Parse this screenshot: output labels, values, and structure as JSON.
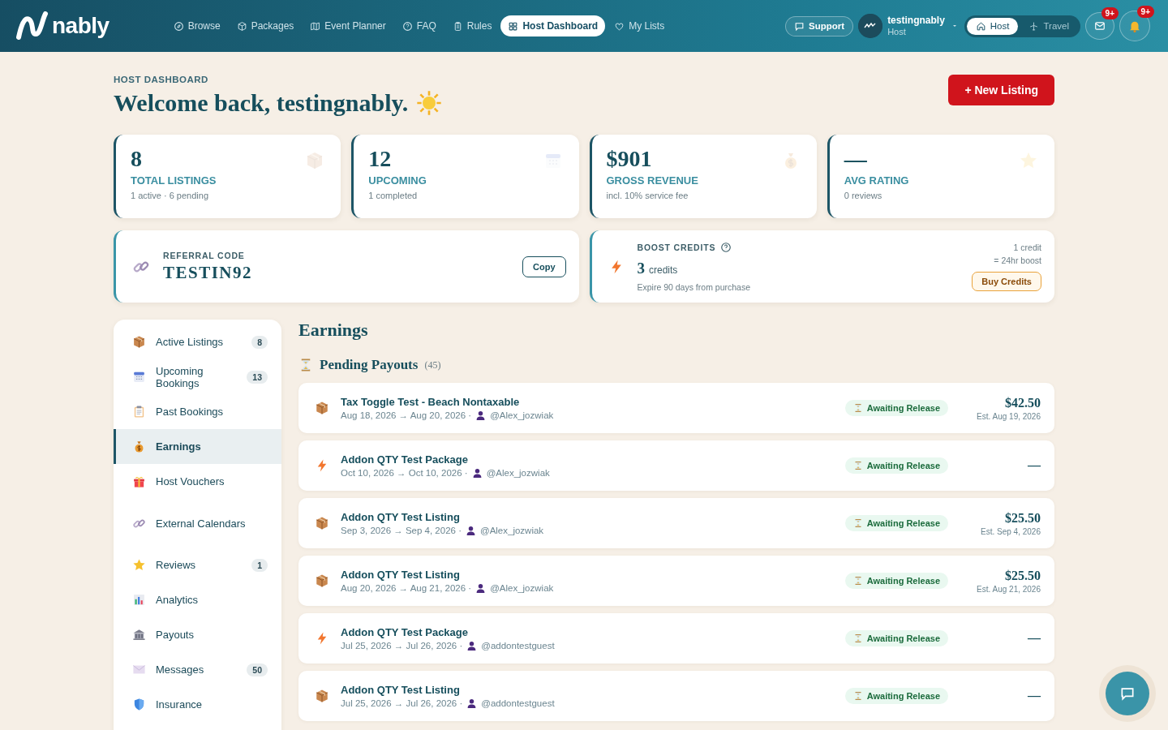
{
  "nav": {
    "logo": "nably",
    "links": [
      {
        "label": "Browse",
        "kind": "compass",
        "selected": false
      },
      {
        "label": "Packages",
        "kind": "cube",
        "selected": false
      },
      {
        "label": "Event Planner",
        "kind": "map",
        "selected": false
      },
      {
        "label": "FAQ",
        "kind": "question",
        "selected": false
      },
      {
        "label": "Rules",
        "kind": "clipboard-line",
        "selected": false
      },
      {
        "label": "Host Dashboard",
        "kind": "grid",
        "selected": true
      },
      {
        "label": "My Lists",
        "kind": "heart",
        "selected": false
      }
    ],
    "support": "Support",
    "user": {
      "name": "testingnably",
      "role": "Host"
    },
    "modes": [
      {
        "label": "Host",
        "kind": "home",
        "selected": true
      },
      {
        "label": "Travel",
        "kind": "plane",
        "selected": false
      }
    ],
    "mail_badge": "9+",
    "bell_badge": "9+"
  },
  "header": {
    "eyebrow": "HOST DASHBOARD",
    "title": "Welcome back, testingnably.",
    "new_listing": "+ New Listing"
  },
  "stats": [
    {
      "value": "8",
      "label": "TOTAL LISTINGS",
      "sub": "1 active · 6 pending",
      "kind": "box"
    },
    {
      "value": "12",
      "label": "UPCOMING",
      "sub": "1 completed",
      "kind": "calendar"
    },
    {
      "value": "$901",
      "label": "GROSS REVENUE",
      "sub": "incl. 10% service fee",
      "kind": "moneybag"
    },
    {
      "value": "—",
      "label": "AVG RATING",
      "sub": "0 reviews",
      "kind": "star"
    }
  ],
  "referral": {
    "label": "REFERRAL CODE",
    "code": "TESTIN92",
    "button": "Copy"
  },
  "boost": {
    "label": "BOOST CREDITS",
    "count": "3",
    "unit": "credits",
    "note": "Expire 90 days from purchase",
    "rate": [
      "1 credit",
      "= 24hr boost"
    ],
    "button": "Buy Credits"
  },
  "sidebar": {
    "items": [
      {
        "label": "Active Listings",
        "kind": "box",
        "count": "8",
        "selected": false
      },
      {
        "label": "Upcoming Bookings",
        "kind": "calendar",
        "count": "13",
        "selected": false
      },
      {
        "label": "Past Bookings",
        "kind": "clipboard",
        "selected": false
      },
      {
        "label": "Earnings",
        "kind": "moneybag",
        "selected": true
      },
      {
        "label": "Host Vouchers",
        "kind": "gift",
        "selected": false
      },
      {
        "label": "External Calendars",
        "kind": "link",
        "selected": false
      },
      {
        "label": "Reviews",
        "kind": "star",
        "count": "1",
        "selected": false
      },
      {
        "label": "Analytics",
        "kind": "chart",
        "selected": false
      },
      {
        "label": "Payouts",
        "kind": "bank",
        "selected": false
      },
      {
        "label": "Messages",
        "kind": "envelope",
        "count": "50",
        "selected": false
      },
      {
        "label": "Insurance",
        "kind": "shield",
        "selected": false
      }
    ]
  },
  "earnings": {
    "title": "Earnings",
    "pending_title": "Pending Payouts",
    "pending_count": "(45)",
    "payouts": [
      {
        "kind": "box",
        "title": "Tax Toggle Test - Beach Nontaxable",
        "dates": "Aug 18, 2026 → Aug 20, 2026 ·",
        "user": "@Alex_jozwiak",
        "status": "Awaiting Release",
        "amount": "$42.50",
        "est": "Est. Aug 19, 2026"
      },
      {
        "kind": "bolt",
        "title": "Addon QTY Test Package",
        "dates": "Oct 10, 2026 → Oct 10, 2026 ·",
        "user": "@Alex_jozwiak",
        "status": "Awaiting Release",
        "amount": "—"
      },
      {
        "kind": "box",
        "title": "Addon QTY Test Listing",
        "dates": "Sep 3, 2026 → Sep 4, 2026 ·",
        "user": "@Alex_jozwiak",
        "status": "Awaiting Release",
        "amount": "$25.50",
        "est": "Est. Sep 4, 2026"
      },
      {
        "kind": "box",
        "title": "Addon QTY Test Listing",
        "dates": "Aug 20, 2026 → Aug 21, 2026 ·",
        "user": "@Alex_jozwiak",
        "status": "Awaiting Release",
        "amount": "$25.50",
        "est": "Est. Aug 21, 2026"
      },
      {
        "kind": "bolt",
        "title": "Addon QTY Test Package",
        "dates": "Jul 25, 2026 → Jul 26, 2026 ·",
        "user": "@addontestguest",
        "status": "Awaiting Release",
        "amount": "—"
      },
      {
        "kind": "box",
        "title": "Addon QTY Test Listing",
        "dates": "Jul 25, 2026 → Jul 26, 2026 ·",
        "user": "@addontestguest",
        "status": "Awaiting Release",
        "amount": "—"
      }
    ]
  }
}
